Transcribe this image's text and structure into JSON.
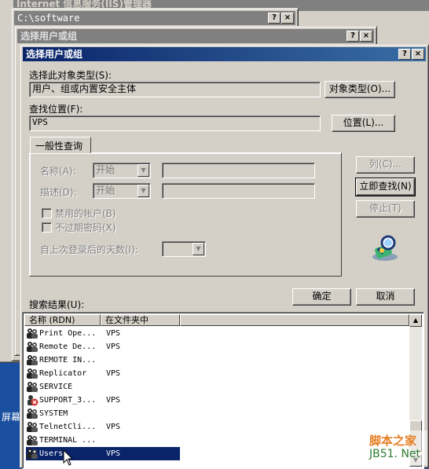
{
  "background_windows": {
    "iis_title": "Internet 信息服务(IIS)管理器",
    "folder_title": "C:\\software",
    "parent_dialog_title": "选择用户或组",
    "desktop_text": "屏幕"
  },
  "dialog": {
    "title": "选择用户或组",
    "help_button": "?",
    "close_button": "×",
    "object_type_label": "选择此对象类型(S):",
    "object_type_value": "用户、组或内置安全主体",
    "object_type_button": "对象类型(O)...",
    "location_label": "查找位置(F):",
    "location_value": "VPS",
    "location_button": "位置(L)...",
    "tab_label": "一般性查询",
    "name_label": "名称(A):",
    "name_combo": "开始",
    "desc_label": "描述(D):",
    "desc_combo": "开始",
    "disabled_accounts": "禁用的帐户(B)",
    "non_expiring_password": "不过期密码(X)",
    "days_since_login": "自上次登录后的天数(I):",
    "columns_button": "列(C)...",
    "find_now_button": "立即查找(N)",
    "stop_button": "停止(T)",
    "ok_button": "确定",
    "cancel_button": "取消",
    "results_label": "搜索结果(U):"
  },
  "results": {
    "columns": [
      "名称 (RDN)",
      "在文件夹中"
    ],
    "rows": [
      {
        "name": "Print Ope...",
        "folder": "VPS",
        "icon": "group-icon"
      },
      {
        "name": "Remote De...",
        "folder": "VPS",
        "icon": "group-icon"
      },
      {
        "name": "REMOTE IN...",
        "folder": "",
        "icon": "group-icon"
      },
      {
        "name": "Replicator",
        "folder": "VPS",
        "icon": "group-icon"
      },
      {
        "name": "SERVICE",
        "folder": "",
        "icon": "group-icon"
      },
      {
        "name": "SUPPORT_3...",
        "folder": "VPS",
        "icon": "disabled-user-icon"
      },
      {
        "name": "SYSTEM",
        "folder": "",
        "icon": "group-icon"
      },
      {
        "name": "TelnetCli...",
        "folder": "VPS",
        "icon": "group-icon"
      },
      {
        "name": "TERMINAL ...",
        "folder": "",
        "icon": "group-icon"
      },
      {
        "name": "Users",
        "folder": "VPS",
        "icon": "group-icon",
        "selected": true
      }
    ]
  },
  "watermark": {
    "line1": "脚本之家",
    "line2": "JB51. Net"
  },
  "colors": {
    "title_active": "#0a246a",
    "face": "#d4d0c8",
    "desktop": "#1a4fa0"
  }
}
